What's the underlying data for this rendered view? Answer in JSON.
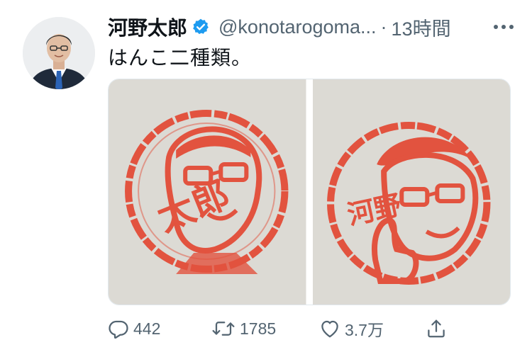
{
  "author": {
    "display_name": "河野太郎",
    "handle": "@konotarogoma...",
    "separator": "·",
    "timestamp": "13時間"
  },
  "tweet": {
    "text": "はんこ二種類。"
  },
  "media": {
    "stamp_left_text": "太郎",
    "stamp_right_text": "河野",
    "stamp_color": "#e2533f",
    "paper_color": "#dcdad4"
  },
  "actions": {
    "reply_count": "442",
    "retweet_count": "1785",
    "like_count": "3.7万"
  },
  "colors": {
    "verified": "#1d9bf0",
    "secondary_text": "#536471",
    "primary_text": "#0f1419"
  }
}
